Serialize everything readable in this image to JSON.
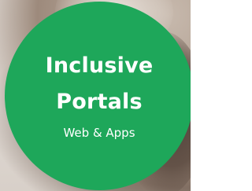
{
  "badge": {
    "title_line_1": "Inclusive",
    "title_line_2": "Portals",
    "subtitle": "Web & Apps"
  },
  "colors": {
    "circle": "#1ea75a",
    "text": "#ffffff"
  }
}
